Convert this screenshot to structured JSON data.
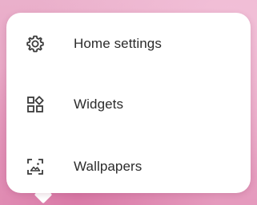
{
  "menu": {
    "items": [
      {
        "label": "Home settings",
        "icon": "gear-icon"
      },
      {
        "label": "Widgets",
        "icon": "widgets-icon"
      },
      {
        "label": "Wallpapers",
        "icon": "wallpaper-icon"
      }
    ]
  },
  "colors": {
    "background": "#e9a4c4",
    "card": "#ffffff",
    "text": "#2b2b2b",
    "icon": "#3a3a3a"
  }
}
